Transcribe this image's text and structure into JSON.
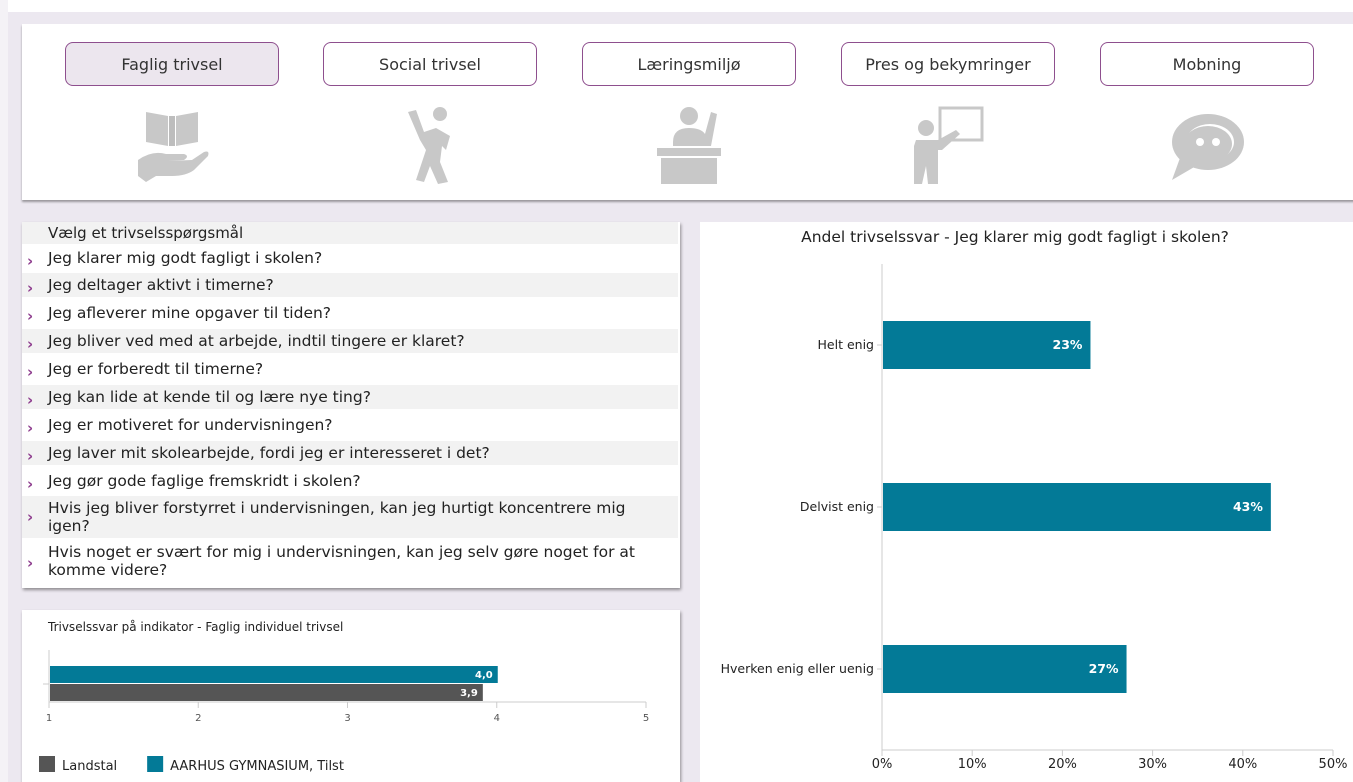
{
  "tabs": [
    {
      "label": "Faglig trivsel",
      "icon": "book-hand-icon",
      "active": true
    },
    {
      "label": "Social trivsel",
      "icon": "person-waving-icon",
      "active": false
    },
    {
      "label": "Læringsmiljø",
      "icon": "person-desk-icon",
      "active": false
    },
    {
      "label": "Pres og bekymringer",
      "icon": "teacher-board-icon",
      "active": false
    },
    {
      "label": "Mobning",
      "icon": "speech-bubble-icon",
      "active": false
    }
  ],
  "question_list": {
    "header": "Vælg et trivselsspørgsmål",
    "items": [
      "Jeg klarer mig godt fagligt i skolen?",
      "Jeg deltager aktivt i timerne?",
      "Jeg afleverer mine opgaver til tiden?",
      "Jeg bliver ved med at arbejde, indtil tingere er klaret?",
      "Jeg er forberedt til timerne?",
      "Jeg kan lide at kende til og lære nye ting?",
      "Jeg er motiveret for undervisningen?",
      "Jeg laver mit skolearbejde, fordi jeg er interesseret i det?",
      "Jeg gør gode faglige fremskridt i skolen?",
      "Hvis jeg bliver forstyrret i undervisningen, kan jeg hurtigt koncentrere mig igen?",
      "Hvis noget er svært for mig i undervisningen, kan jeg selv gøre noget for at komme videre?"
    ]
  },
  "colors": {
    "teal": "#037a97",
    "gray": "#555555",
    "accent": "#8e4f8e"
  },
  "chart_data": [
    {
      "type": "bar",
      "orientation": "horizontal",
      "title": "Andel trivselssvar - Jeg klarer mig godt fagligt i skolen?",
      "categories": [
        "Helt enig",
        "Delvist enig",
        "Hverken enig eller uenig"
      ],
      "values": [
        23,
        43,
        27
      ],
      "value_labels": [
        "23%",
        "43%",
        "27%"
      ],
      "xlim": [
        0,
        50
      ],
      "xticks": [
        "0%",
        "10%",
        "20%",
        "30%",
        "40%",
        "50%"
      ]
    },
    {
      "type": "bar",
      "orientation": "horizontal",
      "title": "Trivselssvar på indikator - Faglig individuel trivsel",
      "series": [
        {
          "name": "AARHUS GYMNASIUM, Tilst",
          "value": 4.0,
          "label": "4,0"
        },
        {
          "name": "Landstal",
          "value": 3.9,
          "label": "3,9"
        }
      ],
      "xlim": [
        1,
        5
      ],
      "xticks": [
        "1",
        "2",
        "3",
        "4",
        "5"
      ],
      "legend": [
        {
          "name": "Landstal",
          "color": "#555555"
        },
        {
          "name": "AARHUS GYMNASIUM, Tilst",
          "color": "#037a97"
        }
      ],
      "legend_position": "bottom"
    }
  ]
}
